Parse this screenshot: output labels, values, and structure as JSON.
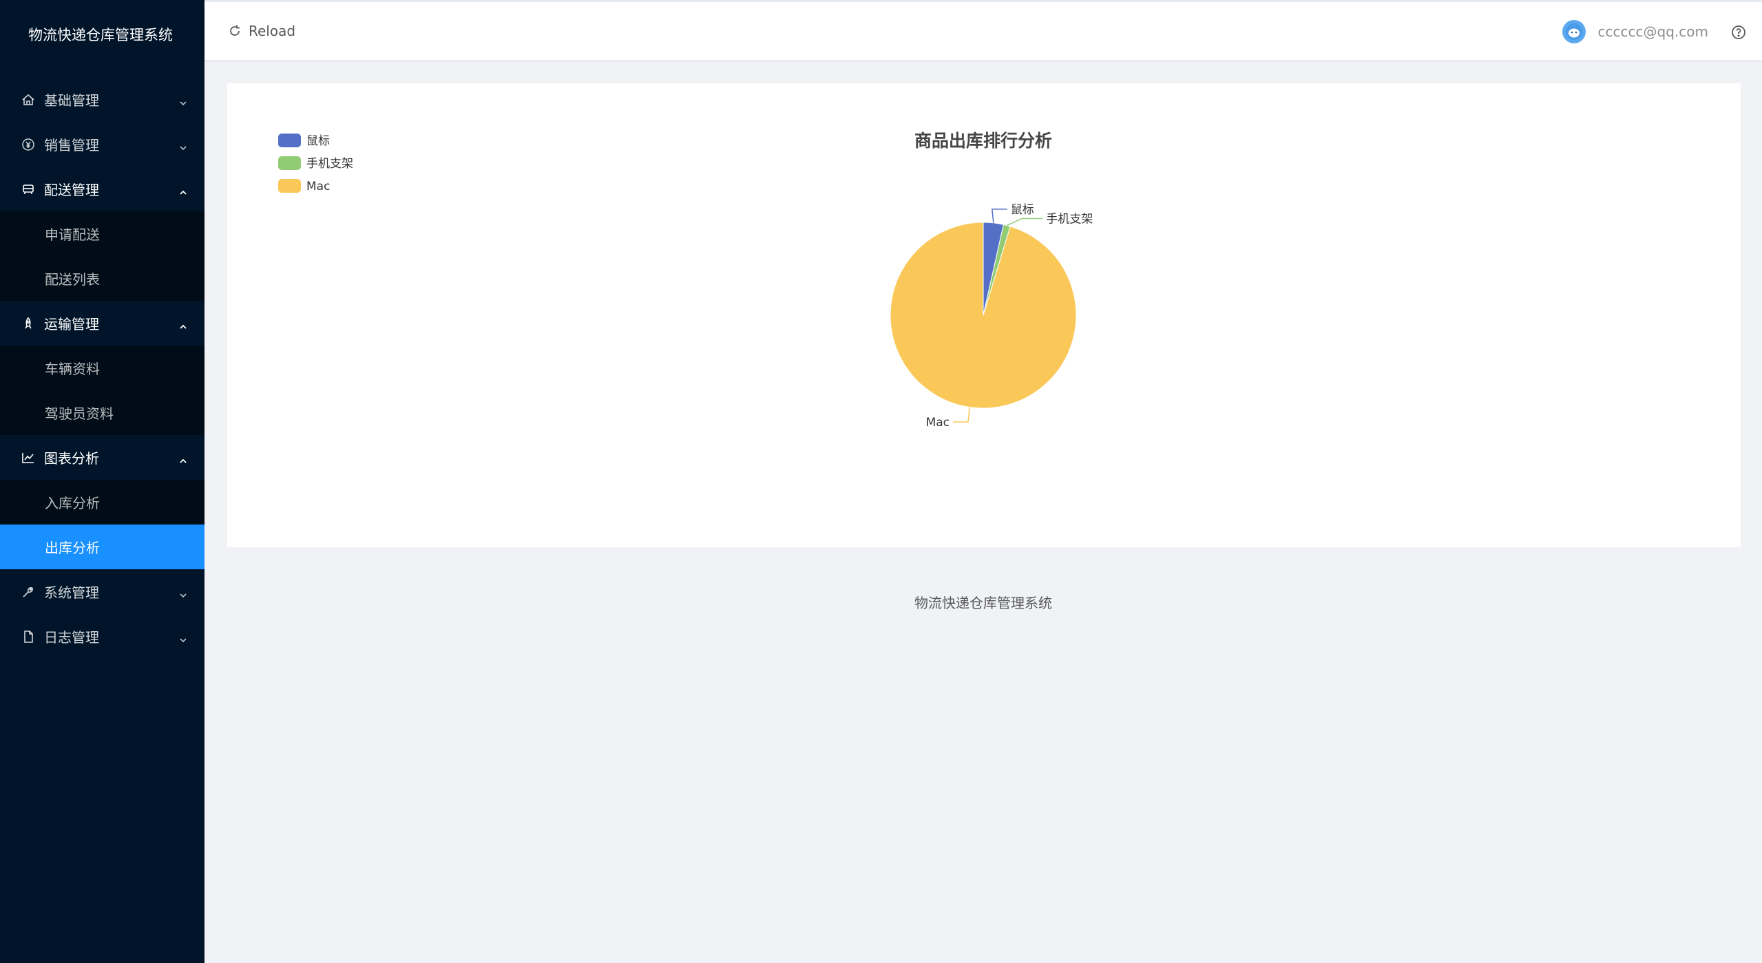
{
  "app": {
    "title": "物流快递仓库管理系统"
  },
  "sidebar": {
    "items": [
      {
        "label": "基础管理",
        "icon": "home-icon",
        "open": false
      },
      {
        "label": "销售管理",
        "icon": "yen-icon",
        "open": false
      },
      {
        "label": "配送管理",
        "icon": "car-icon",
        "open": true,
        "children": [
          "申请配送",
          "配送列表"
        ]
      },
      {
        "label": "运输管理",
        "icon": "rocket-icon",
        "open": true,
        "children": [
          "车辆资料",
          "驾驶员资料"
        ]
      },
      {
        "label": "图表分析",
        "icon": "line-chart-icon",
        "open": true,
        "children": [
          "入库分析",
          "出库分析"
        ]
      },
      {
        "label": "系统管理",
        "icon": "tool-icon",
        "open": false
      },
      {
        "label": "日志管理",
        "icon": "file-icon",
        "open": false
      }
    ],
    "active": "出库分析"
  },
  "header": {
    "reload_label": "Reload",
    "user_email": "cccccc@qq.com"
  },
  "footer": {
    "text": "物流快递仓库管理系统"
  },
  "colors": {
    "sidebar_bg": "#001529",
    "active": "#1890ff",
    "series": [
      "#5470c6",
      "#91cc75",
      "#fac858"
    ]
  },
  "chart_data": {
    "type": "pie",
    "title": "商品出库排行分析",
    "legend_position": "top-left",
    "slices": [
      {
        "name": "鼠标",
        "value": 3.5,
        "color": "#5470c6"
      },
      {
        "name": "手机支架",
        "value": 1.2,
        "color": "#91cc75"
      },
      {
        "name": "Mac",
        "value": 95.3,
        "color": "#fac858"
      }
    ]
  }
}
